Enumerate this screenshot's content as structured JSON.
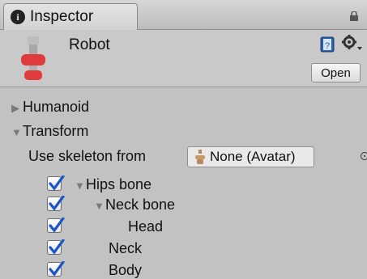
{
  "tab": {
    "label": "Inspector",
    "icon": "info-icon"
  },
  "header": {
    "object_name": "Robot",
    "open_label": "Open"
  },
  "sections": {
    "humanoid": "Humanoid",
    "transform": "Transform"
  },
  "skeleton": {
    "label": "Use skeleton from",
    "value": "None (Avatar)"
  },
  "bones": [
    {
      "label": "Hips bone",
      "checked": true,
      "expanded": true
    },
    {
      "label": "Neck bone",
      "checked": true,
      "expanded": true
    },
    {
      "label": "Head",
      "checked": true
    },
    {
      "label": "Neck",
      "checked": true
    },
    {
      "label": "Body",
      "checked": true
    }
  ],
  "colors": {
    "panel": "#c2c2c2",
    "check": "#1a55c8",
    "avatar_red": "#e03b3b"
  }
}
